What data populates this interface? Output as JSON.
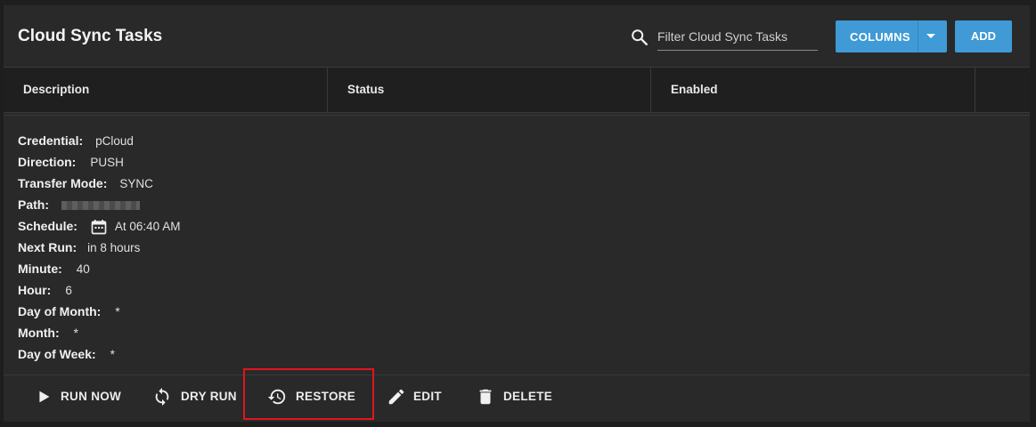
{
  "header": {
    "title": "Cloud Sync Tasks",
    "search_placeholder": "Filter Cloud Sync Tasks",
    "columns_label": "COLUMNS",
    "add_label": "ADD"
  },
  "table": {
    "columns": [
      "Description",
      "Status",
      "Enabled"
    ]
  },
  "details": {
    "credential": {
      "label": "Credential:",
      "value": "pCloud"
    },
    "direction": {
      "label": "Direction:",
      "value": "PUSH"
    },
    "transfer_mode": {
      "label": "Transfer Mode:",
      "value": "SYNC"
    },
    "path": {
      "label": "Path:"
    },
    "schedule": {
      "label": "Schedule:",
      "value": "At 06:40 AM"
    },
    "next_run": {
      "label": "Next Run:",
      "value": "in 8 hours"
    },
    "minute": {
      "label": "Minute:",
      "value": "40"
    },
    "hour": {
      "label": "Hour:",
      "value": "6"
    },
    "day_of_month": {
      "label": "Day of Month:",
      "value": "*"
    },
    "month": {
      "label": "Month:",
      "value": "*"
    },
    "day_of_week": {
      "label": "Day of Week:",
      "value": "*"
    }
  },
  "actions": {
    "run_now": "RUN NOW",
    "dry_run": "DRY RUN",
    "restore": "RESTORE",
    "edit": "EDIT",
    "delete": "DELETE"
  },
  "colors": {
    "accent": "#3f9ad6",
    "highlight": "#e0161e",
    "background": "#292929"
  },
  "icons": [
    "search-icon",
    "chevron-down-icon",
    "calendar-icon",
    "play-icon",
    "sync-icon",
    "history-icon",
    "pencil-icon",
    "trash-icon"
  ]
}
